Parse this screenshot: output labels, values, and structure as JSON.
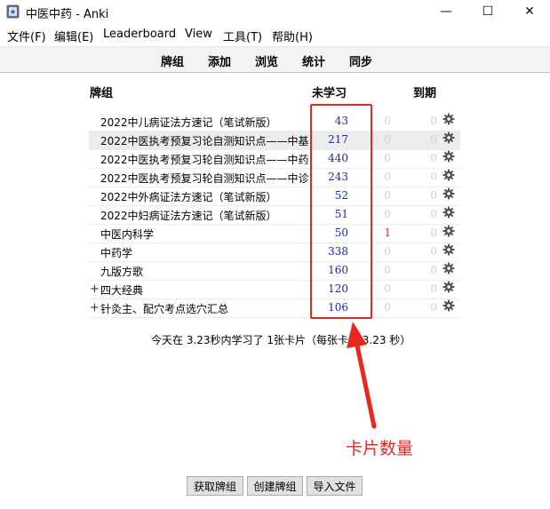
{
  "window": {
    "title": "中医中药 - Anki",
    "minimize_glyph": "—",
    "maximize_glyph": "☐",
    "close_glyph": "✕"
  },
  "menu": [
    "文件(F)",
    "编辑(E)",
    "Leaderboard",
    "View",
    "工具(T)",
    "帮助(H)"
  ],
  "toolbar": [
    "牌组",
    "添加",
    "浏览",
    "统计",
    "同步"
  ],
  "table": {
    "col_deck": "牌组",
    "col_new": "未学习",
    "col_due": "到期"
  },
  "decks": [
    {
      "expander": "",
      "name": "2022中儿病证法方速记（笔试新版）",
      "new": "43",
      "learn": "0",
      "due": "0",
      "highlight": false
    },
    {
      "expander": "",
      "name": "2022中医执考预复习论自测知识点——中基",
      "new": "217",
      "learn": "0",
      "due": "0",
      "highlight": true
    },
    {
      "expander": "",
      "name": "2022中医执考预复习轮自测知识点——中药",
      "new": "440",
      "learn": "0",
      "due": "0",
      "highlight": false
    },
    {
      "expander": "",
      "name": "2022中医执考预复习轮自测知识点——中诊",
      "new": "243",
      "learn": "0",
      "due": "0",
      "highlight": false
    },
    {
      "expander": "",
      "name": "2022中外病证法方速记（笔试新版）",
      "new": "52",
      "learn": "0",
      "due": "0",
      "highlight": false
    },
    {
      "expander": "",
      "name": "2022中妇病证法方速记（笔试新版）",
      "new": "51",
      "learn": "0",
      "due": "0",
      "highlight": false
    },
    {
      "expander": "",
      "name": "中医内科学",
      "new": "50",
      "learn": "1",
      "due": "0",
      "highlight": false
    },
    {
      "expander": "",
      "name": "中药学",
      "new": "338",
      "learn": "0",
      "due": "0",
      "highlight": false
    },
    {
      "expander": "",
      "name": "九版方歌",
      "new": "160",
      "learn": "0",
      "due": "0",
      "highlight": false
    },
    {
      "expander": "+",
      "name": "四大经典",
      "new": "120",
      "learn": "0",
      "due": "0",
      "highlight": false
    },
    {
      "expander": "+",
      "name": "针灸主、配穴考点选穴汇总",
      "new": "106",
      "learn": "0",
      "due": "0",
      "highlight": false
    }
  ],
  "summary": "今天在 3.23秒内学习了 1张卡片（每张卡片 3.23 秒）",
  "annotation": {
    "label": "卡片数量",
    "color": "#e8281f"
  },
  "buttons": [
    "获取牌组",
    "创建牌组",
    "导入文件"
  ],
  "colors": {
    "new_count": "#1a2aa8",
    "learn_count": "#c0392b",
    "zero_count": "#cfcfcf"
  }
}
